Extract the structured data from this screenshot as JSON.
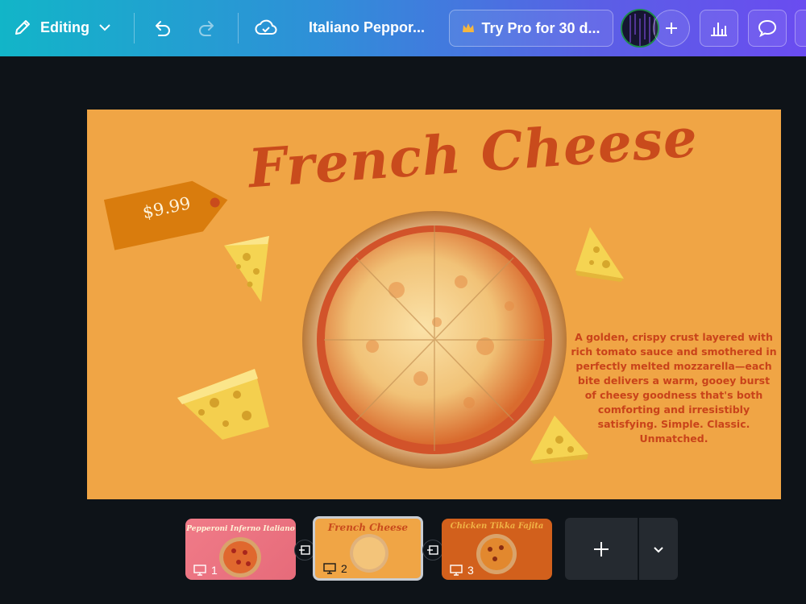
{
  "topbar": {
    "editing_label": "Editing",
    "title": "Italiano Peppor...",
    "promo_label": "Try Pro for 30 d..."
  },
  "slide": {
    "title": "French Cheese",
    "price": "$9.99",
    "description": "A golden, crispy crust layered with rich tomato sauce and smothered in perfectly melted mozzarella—each bite delivers a warm, gooey burst of cheesy goodness that's both comforting and irresistibly satisfying. Simple. Classic. Unmatched."
  },
  "pages": [
    {
      "number": "1",
      "title": "Pepperoni Inferno Italiano"
    },
    {
      "number": "2",
      "title": "French Cheese"
    },
    {
      "number": "3",
      "title": "Chicken Tikka Fajita"
    }
  ],
  "colors": {
    "slide_bg": "#f0a545",
    "title_color": "#c94b1c",
    "page3_bg": "#d2601c",
    "page1_bg": "#e8707e"
  }
}
